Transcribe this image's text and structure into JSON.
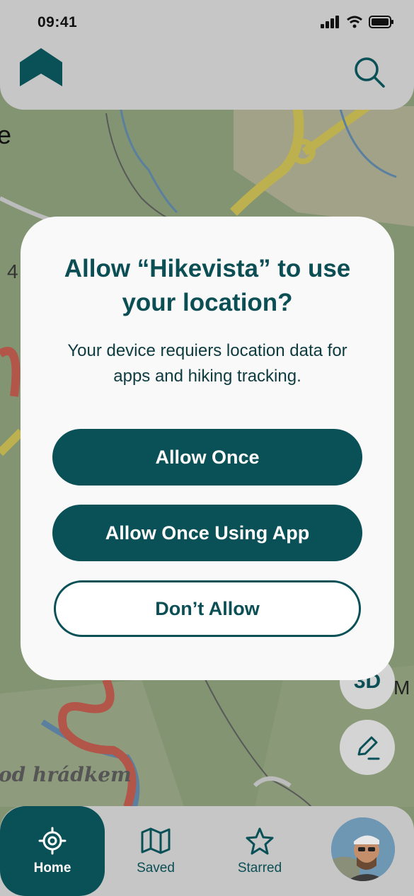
{
  "status_bar": {
    "time": "09:41"
  },
  "map": {
    "place_label": "od hrádkem",
    "edge_letter": "e",
    "edge_number": "4",
    "right_letter": "M"
  },
  "map_controls": {
    "three_d_label": "3D"
  },
  "dialog": {
    "title": "Allow “Hikevista” to use your location?",
    "message": "Your device requiers location data for apps and hiking tracking.",
    "allow_once_label": "Allow Once",
    "allow_using_app_label": "Allow Once Using App",
    "dont_allow_label": "Don’t Allow"
  },
  "bottom_nav": {
    "items": [
      {
        "label": "Home",
        "icon": "location-target-icon",
        "active": true
      },
      {
        "label": "Saved",
        "icon": "map-icon",
        "active": false
      },
      {
        "label": "Starred",
        "icon": "star-icon",
        "active": false
      }
    ]
  },
  "colors": {
    "primary": "#0a5057",
    "dialog_bg": "#f9f9f9",
    "nav_bg": "#c6c6c6"
  }
}
